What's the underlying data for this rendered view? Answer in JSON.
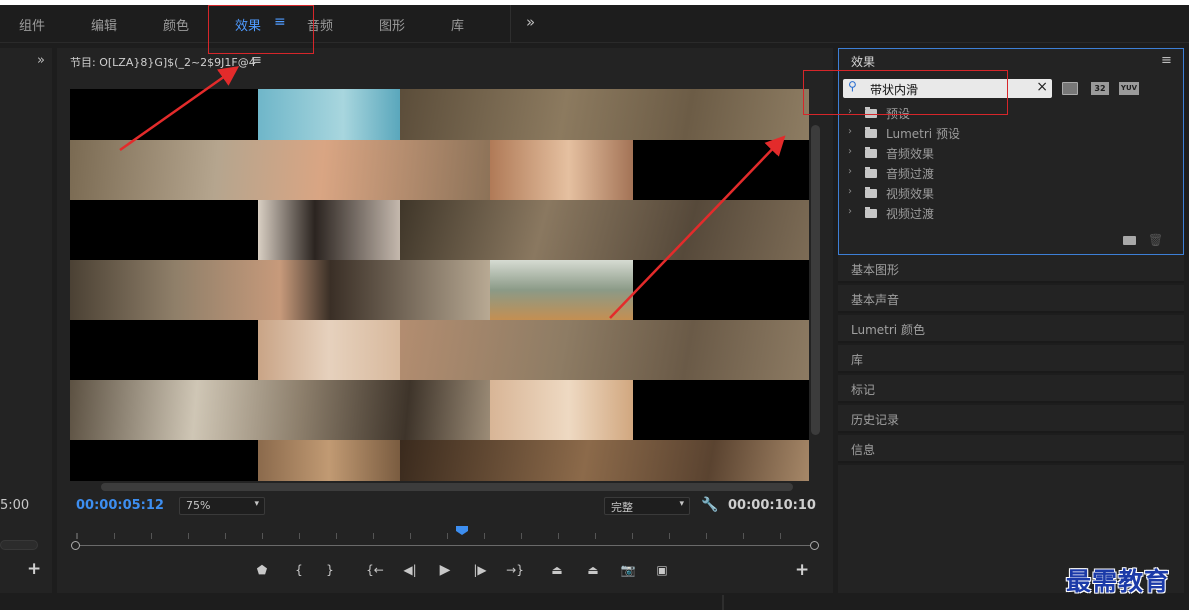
{
  "menu": {
    "items": [
      "组件",
      "编辑",
      "颜色",
      "效果",
      "音频",
      "图形",
      "库"
    ],
    "active_label": "效果",
    "more": "»",
    "hamburger": "≡"
  },
  "program": {
    "title": "节目: O[LZA}8}G]$(_2~2$9J1F@4",
    "menu_icon": "≡",
    "timecode_current": "00:00:05:12",
    "zoom": "75%",
    "quality": "完整",
    "timecode_total": "00:00:10:10",
    "add": "+"
  },
  "left_panel": {
    "more": "»",
    "time_fragment": "5:00",
    "add": "+"
  },
  "effects_panel": {
    "title": "效果",
    "menu_icon": "≡",
    "search_value": "带状内滑",
    "clear": "×",
    "badges": [
      "32",
      "YUV"
    ],
    "tree": [
      "预设",
      "Lumetri 预设",
      "音频效果",
      "音频过渡",
      "视频效果",
      "视频过渡"
    ]
  },
  "sections": [
    "基本图形",
    "基本声音",
    "Lumetri 颜色",
    "库",
    "标记",
    "历史记录",
    "信息"
  ],
  "watermark": "最需教育",
  "colors": {
    "accent": "#4f9bff",
    "timecode": "#3d8ef0",
    "highlight": "#d6262a",
    "focus_border": "#3d7fd6"
  }
}
